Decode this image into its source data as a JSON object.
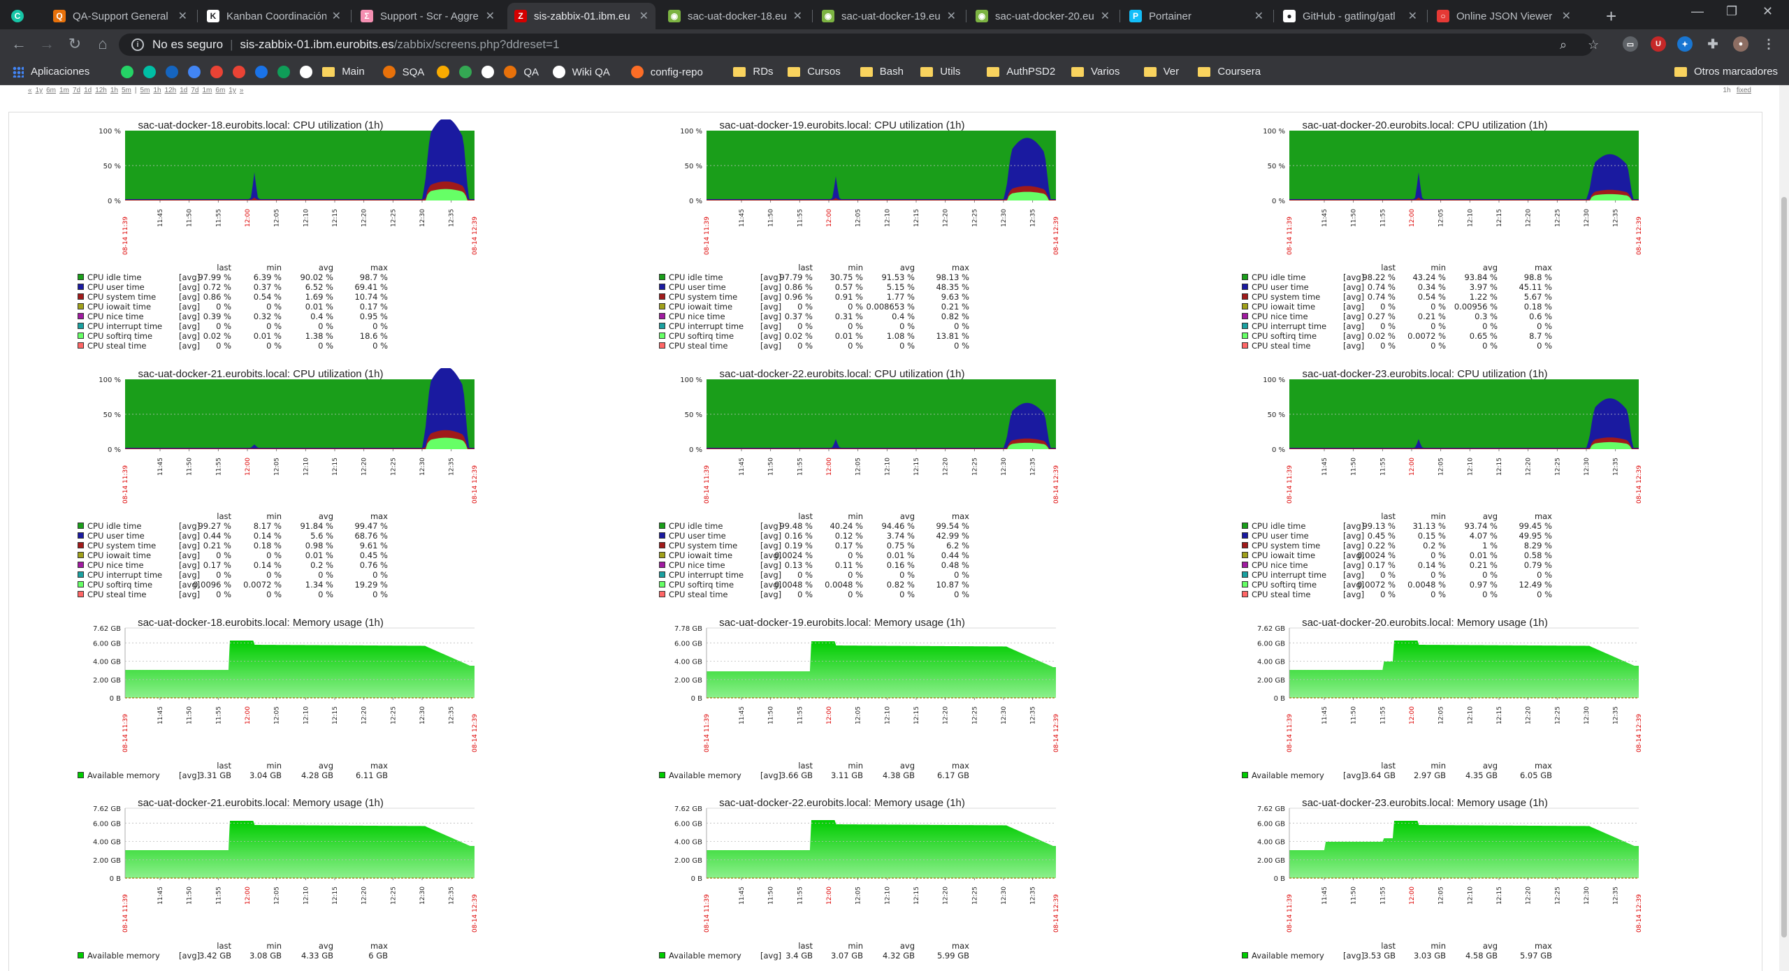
{
  "browser": {
    "tabs": [
      {
        "title": "QA-Support General",
        "fav_color": "#e8710a",
        "fav_glyph": "Q"
      },
      {
        "title": "Kanban Coordinación",
        "fav_color": "#ffffff",
        "fav_glyph": "K"
      },
      {
        "title": "Support - Scr - Aggre",
        "fav_color": "#f48fb1",
        "fav_glyph": "Σ"
      },
      {
        "title": "sis-zabbix-01.ibm.eu",
        "fav_color": "#d40000",
        "fav_glyph": "Z"
      },
      {
        "title": "sac-uat-docker-18.eu",
        "fav_color": "#7cb342",
        "fav_glyph": "◉"
      },
      {
        "title": "sac-uat-docker-19.eu",
        "fav_color": "#7cb342",
        "fav_glyph": "◉"
      },
      {
        "title": "sac-uat-docker-20.eu",
        "fav_color": "#7cb342",
        "fav_glyph": "◉"
      },
      {
        "title": "Portainer",
        "fav_color": "#13bef9",
        "fav_glyph": "P"
      },
      {
        "title": "GitHub - gatling/gatl",
        "fav_color": "#ffffff",
        "fav_glyph": "●"
      },
      {
        "title": "Online JSON Viewer",
        "fav_color": "#e53935",
        "fav_glyph": "○"
      }
    ],
    "active_tab": 3,
    "new_tab": "+",
    "controls": {
      "min": "—",
      "max": "❐",
      "close": "✕"
    },
    "omnibox": {
      "security": "No es seguro",
      "host": "sis-zabbix-01.ibm.eurobits.es",
      "path": "/zabbix/screens.php?ddreset=1"
    },
    "bookmarks": [
      {
        "label": "Aplicaciones",
        "kind": "apps"
      },
      {
        "label": "",
        "kind": "icon",
        "color": "#25d366"
      },
      {
        "label": "",
        "kind": "icon",
        "color": "#00bfa5"
      },
      {
        "label": "",
        "kind": "icon",
        "color": "#1565c0"
      },
      {
        "label": "",
        "kind": "icon",
        "color": "#4285f4"
      },
      {
        "label": "",
        "kind": "icon",
        "color": "#ea4335"
      },
      {
        "label": "",
        "kind": "icon",
        "color": "#ea4335"
      },
      {
        "label": "",
        "kind": "icon",
        "color": "#1a73e8"
      },
      {
        "label": "",
        "kind": "icon",
        "color": "#0f9d58"
      },
      {
        "label": "",
        "kind": "icon",
        "color": "#ffffff"
      },
      {
        "label": "Main",
        "kind": "folder"
      },
      {
        "label": "SQA",
        "kind": "icon",
        "color": "#e8710a"
      },
      {
        "label": "",
        "kind": "icon",
        "color": "#f9ab00"
      },
      {
        "label": "",
        "kind": "icon",
        "color": "#34a853"
      },
      {
        "label": "",
        "kind": "icon",
        "color": "#ffffff"
      },
      {
        "label": "QA",
        "kind": "icon",
        "color": "#e8710a"
      },
      {
        "label": "Wiki QA",
        "kind": "icon",
        "color": "#ffffff"
      },
      {
        "label": "config-repo",
        "kind": "icon",
        "color": "#fc6d26"
      },
      {
        "label": "RDs",
        "kind": "folder"
      },
      {
        "label": "Cursos",
        "kind": "folder"
      },
      {
        "label": "Bash",
        "kind": "folder"
      },
      {
        "label": "Utils",
        "kind": "folder"
      },
      {
        "label": "AuthPSD2",
        "kind": "folder"
      },
      {
        "label": "Varios",
        "kind": "folder"
      },
      {
        "label": "Ver",
        "kind": "folder"
      },
      {
        "label": "Coursera",
        "kind": "folder"
      }
    ],
    "other_bookmarks": "Otros marcadores"
  },
  "zabbix": {
    "periods": [
      "«",
      "1y",
      "6m",
      "1m",
      "7d",
      "1d",
      "12h",
      "1h",
      "5m",
      "|",
      "5m",
      "1h",
      "12h",
      "1d",
      "7d",
      "1m",
      "6m",
      "1y",
      "»"
    ],
    "fixed": [
      "1h",
      "fixed"
    ],
    "time_ticks": [
      "11:45",
      "11:50",
      "11:55",
      "12:00",
      "12:05",
      "12:10",
      "12:15",
      "12:20",
      "12:25",
      "12:30",
      "12:35"
    ],
    "time_start": "08-14 11:39",
    "time_end": "08-14 12:39",
    "legend_header": [
      "last",
      "min",
      "avg",
      "max"
    ],
    "cpu_series": [
      {
        "name": "CPU idle time",
        "color": "#1a9e1a"
      },
      {
        "name": "CPU user time",
        "color": "#1a1aa0"
      },
      {
        "name": "CPU system time",
        "color": "#a01a1a"
      },
      {
        "name": "CPU iowait time",
        "color": "#a0a01a"
      },
      {
        "name": "CPU nice time",
        "color": "#a01aa0"
      },
      {
        "name": "CPU interrupt time",
        "color": "#1aa0a0"
      },
      {
        "name": "CPU softirq time",
        "color": "#66ff66"
      },
      {
        "name": "CPU steal time",
        "color": "#ff6666"
      }
    ],
    "cpu_axis": [
      "100 %",
      "50 %",
      "0 %"
    ],
    "cpu_graphs": [
      {
        "title": "sac-uat-docker-18.eurobits.local: CPU utilization (1h)",
        "rows": [
          [
            "[avg]",
            "97.99 %",
            "6.39 %",
            "90.02 %",
            "98.7 %"
          ],
          [
            "[avg]",
            "0.72 %",
            "0.37 %",
            "6.52 %",
            "69.41 %"
          ],
          [
            "[avg]",
            "0.86 %",
            "0.54 %",
            "1.69 %",
            "10.74 %"
          ],
          [
            "[avg]",
            "0 %",
            "0 %",
            "0.01 %",
            "0.17 %"
          ],
          [
            "[avg]",
            "0.39 %",
            "0.32 %",
            "0.4 %",
            "0.95 %"
          ],
          [
            "[avg]",
            "0 %",
            "0 %",
            "0 %",
            "0 %"
          ],
          [
            "[avg]",
            "0.02 %",
            "0.01 %",
            "1.38 %",
            "18.6 %"
          ],
          [
            "[avg]",
            "0 %",
            "0 %",
            "0 %",
            "0 %"
          ]
        ]
      },
      {
        "title": "sac-uat-docker-19.eurobits.local: CPU utilization (1h)",
        "rows": [
          [
            "[avg]",
            "97.79 %",
            "30.75 %",
            "91.53 %",
            "98.13 %"
          ],
          [
            "[avg]",
            "0.86 %",
            "0.57 %",
            "5.15 %",
            "48.35 %"
          ],
          [
            "[avg]",
            "0.96 %",
            "0.91 %",
            "1.77 %",
            "9.63 %"
          ],
          [
            "[avg]",
            "0 %",
            "0 %",
            "0.008653 %",
            "0.21 %"
          ],
          [
            "[avg]",
            "0.37 %",
            "0.31 %",
            "0.4 %",
            "0.82 %"
          ],
          [
            "[avg]",
            "0 %",
            "0 %",
            "0 %",
            "0 %"
          ],
          [
            "[avg]",
            "0.02 %",
            "0.01 %",
            "1.08 %",
            "13.81 %"
          ],
          [
            "[avg]",
            "0 %",
            "0 %",
            "0 %",
            "0 %"
          ]
        ]
      },
      {
        "title": "sac-uat-docker-20.eurobits.local: CPU utilization (1h)",
        "rows": [
          [
            "[avg]",
            "98.22 %",
            "43.24 %",
            "93.84 %",
            "98.8 %"
          ],
          [
            "[avg]",
            "0.74 %",
            "0.34 %",
            "3.97 %",
            "45.11 %"
          ],
          [
            "[avg]",
            "0.74 %",
            "0.54 %",
            "1.22 %",
            "5.67 %"
          ],
          [
            "[avg]",
            "0 %",
            "0 %",
            "0.00956 %",
            "0.18 %"
          ],
          [
            "[avg]",
            "0.27 %",
            "0.21 %",
            "0.3 %",
            "0.6 %"
          ],
          [
            "[avg]",
            "0 %",
            "0 %",
            "0 %",
            "0 %"
          ],
          [
            "[avg]",
            "0.02 %",
            "0.0072 %",
            "0.65 %",
            "8.7 %"
          ],
          [
            "[avg]",
            "0 %",
            "0 %",
            "0 %",
            "0 %"
          ]
        ]
      },
      {
        "title": "sac-uat-docker-21.eurobits.local: CPU utilization (1h)",
        "rows": [
          [
            "[avg]",
            "99.27 %",
            "8.17 %",
            "91.84 %",
            "99.47 %"
          ],
          [
            "[avg]",
            "0.44 %",
            "0.14 %",
            "5.6 %",
            "68.76 %"
          ],
          [
            "[avg]",
            "0.21 %",
            "0.18 %",
            "0.98 %",
            "9.61 %"
          ],
          [
            "[avg]",
            "0 %",
            "0 %",
            "0.01 %",
            "0.45 %"
          ],
          [
            "[avg]",
            "0.17 %",
            "0.14 %",
            "0.2 %",
            "0.76 %"
          ],
          [
            "[avg]",
            "0 %",
            "0 %",
            "0 %",
            "0 %"
          ],
          [
            "[avg]",
            "0.0096 %",
            "0.0072 %",
            "1.34 %",
            "19.29 %"
          ],
          [
            "[avg]",
            "0 %",
            "0 %",
            "0 %",
            "0 %"
          ]
        ]
      },
      {
        "title": "sac-uat-docker-22.eurobits.local: CPU utilization (1h)",
        "rows": [
          [
            "[avg]",
            "99.48 %",
            "40.24 %",
            "94.46 %",
            "99.54 %"
          ],
          [
            "[avg]",
            "0.16 %",
            "0.12 %",
            "3.74 %",
            "42.99 %"
          ],
          [
            "[avg]",
            "0.19 %",
            "0.17 %",
            "0.75 %",
            "6.2 %"
          ],
          [
            "[avg]",
            "0.0024 %",
            "0 %",
            "0.01 %",
            "0.44 %"
          ],
          [
            "[avg]",
            "0.13 %",
            "0.11 %",
            "0.16 %",
            "0.48 %"
          ],
          [
            "[avg]",
            "0 %",
            "0 %",
            "0 %",
            "0 %"
          ],
          [
            "[avg]",
            "0.0048 %",
            "0.0048 %",
            "0.82 %",
            "10.87 %"
          ],
          [
            "[avg]",
            "0 %",
            "0 %",
            "0 %",
            "0 %"
          ]
        ]
      },
      {
        "title": "sac-uat-docker-23.eurobits.local: CPU utilization (1h)",
        "rows": [
          [
            "[avg]",
            "99.13 %",
            "31.13 %",
            "93.74 %",
            "99.45 %"
          ],
          [
            "[avg]",
            "0.45 %",
            "0.15 %",
            "4.07 %",
            "49.95 %"
          ],
          [
            "[avg]",
            "0.22 %",
            "0.2 %",
            "1 %",
            "8.29 %"
          ],
          [
            "[avg]",
            "0.0024 %",
            "0 %",
            "0.01 %",
            "0.58 %"
          ],
          [
            "[avg]",
            "0.17 %",
            "0.14 %",
            "0.21 %",
            "0.79 %"
          ],
          [
            "[avg]",
            "0 %",
            "0 %",
            "0 %",
            "0 %"
          ],
          [
            "[avg]",
            "0.0072 %",
            "0.0048 %",
            "0.97 %",
            "12.49 %"
          ],
          [
            "[avg]",
            "0 %",
            "0 %",
            "0 %",
            "0 %"
          ]
        ]
      }
    ],
    "mem_series_name": "Available memory",
    "mem_series_color": "#00cc00",
    "mem_graphs": [
      {
        "title": "sac-uat-docker-18.eurobits.local: Memory usage (1h)",
        "axis": [
          "7.62 GB",
          "6.00 GB",
          "4.00 GB",
          "2.00 GB",
          "0 B"
        ],
        "row": [
          "[avg]",
          "3.31 GB",
          "3.04 GB",
          "4.28 GB",
          "6.11 GB"
        ]
      },
      {
        "title": "sac-uat-docker-19.eurobits.local: Memory usage (1h)",
        "axis": [
          "7.78 GB",
          "6.00 GB",
          "4.00 GB",
          "2.00 GB",
          "0 B"
        ],
        "row": [
          "[avg]",
          "3.66 GB",
          "3.11 GB",
          "4.38 GB",
          "6.17 GB"
        ]
      },
      {
        "title": "sac-uat-docker-20.eurobits.local: Memory usage (1h)",
        "axis": [
          "7.62 GB",
          "6.00 GB",
          "4.00 GB",
          "2.00 GB",
          "0 B"
        ],
        "row": [
          "[avg]",
          "3.64 GB",
          "2.97 GB",
          "4.35 GB",
          "6.05 GB"
        ]
      },
      {
        "title": "sac-uat-docker-21.eurobits.local: Memory usage (1h)",
        "axis": [
          "7.62 GB",
          "6.00 GB",
          "4.00 GB",
          "2.00 GB",
          "0 B"
        ],
        "row": [
          "[avg]",
          "3.42 GB",
          "3.08 GB",
          "4.33 GB",
          "6 GB"
        ]
      },
      {
        "title": "sac-uat-docker-22.eurobits.local: Memory usage (1h)",
        "axis": [
          "7.62 GB",
          "6.00 GB",
          "4.00 GB",
          "2.00 GB",
          "0 B"
        ],
        "row": [
          "[avg]",
          "3.4 GB",
          "3.07 GB",
          "4.32 GB",
          "5.99 GB"
        ]
      },
      {
        "title": "sac-uat-docker-23.eurobits.local: Memory usage (1h)",
        "axis": [
          "7.62 GB",
          "6.00 GB",
          "4.00 GB",
          "2.00 GB",
          "0 B"
        ],
        "row": [
          "[avg]",
          "3.53 GB",
          "3.03 GB",
          "4.58 GB",
          "5.97 GB"
        ]
      }
    ]
  }
}
